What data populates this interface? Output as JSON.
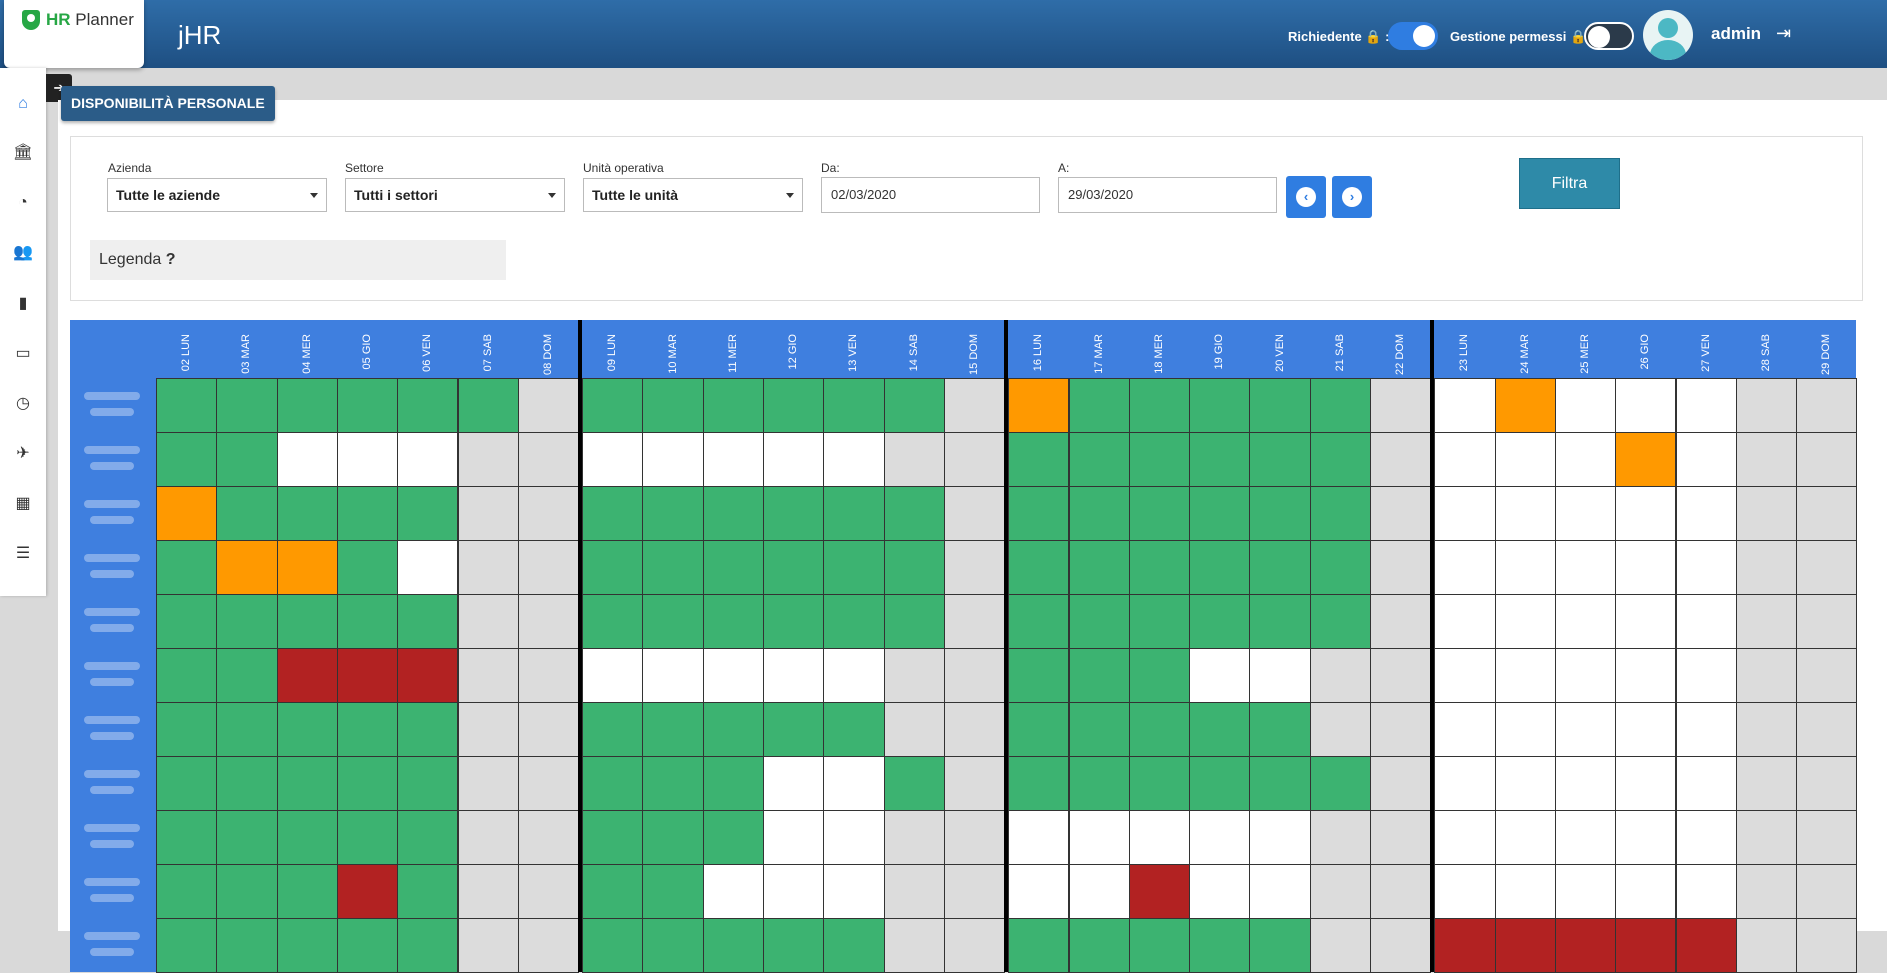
{
  "app": {
    "logo_bold": "HR",
    "logo_rest": " Planner",
    "title": "jHR"
  },
  "header": {
    "richiedente_label": "Richiedente 🔒 :",
    "richiedente_on": true,
    "gestione_label": "Gestione permessi 🔒 :",
    "gestione_on": false,
    "username": "admin",
    "logout_icon": "logout-icon"
  },
  "sidebar": {
    "toggle_icon": "arrow-right-circle-icon",
    "items": [
      {
        "icon": "home-icon",
        "glyph": "⌂"
      },
      {
        "icon": "bank-icon",
        "glyph": "🏛"
      },
      {
        "icon": "pie-chart-icon",
        "glyph": "◔"
      },
      {
        "icon": "users-icon",
        "glyph": "👥"
      },
      {
        "icon": "id-badge-icon",
        "glyph": "▮"
      },
      {
        "icon": "credit-card-icon",
        "glyph": "▭"
      },
      {
        "icon": "clock-icon",
        "glyph": "◷"
      },
      {
        "icon": "plane-icon",
        "glyph": "✈"
      },
      {
        "icon": "calendar-icon",
        "glyph": "▦"
      },
      {
        "icon": "list-icon",
        "glyph": "☰"
      }
    ]
  },
  "page": {
    "badge": "DISPONIBILITÀ PERSONALE"
  },
  "filters": {
    "azienda_label": "Azienda",
    "azienda_value": "Tutte le aziende",
    "settore_label": "Settore",
    "settore_value": "Tutti i settori",
    "unita_label": "Unità operativa",
    "unita_value": "Tutte le unità",
    "da_label": "Da:",
    "da_value": "02/03/2020",
    "a_label": "A:",
    "a_value": "29/03/2020",
    "prev_glyph": "‹",
    "next_glyph": "›",
    "filtra_label": "Filtra",
    "legenda_label": "Legenda",
    "legenda_help": "?"
  },
  "colors": {
    "G": "#3cb371",
    "W": "#ffffff",
    "O": "#ff9900",
    "R": "#b22222",
    "X": "#dcdcdc",
    "header": "#3f7fdf"
  },
  "days": [
    "02 LUN",
    "03 MAR",
    "04 MER",
    "05 GIO",
    "06 VEN",
    "07 SAB",
    "08 DOM",
    "09 LUN",
    "10 MAR",
    "11 MER",
    "12 GIO",
    "13 VEN",
    "14 SAB",
    "15 DOM",
    "16 LUN",
    "17 MAR",
    "18 MER",
    "19 GIO",
    "20 VEN",
    "21 SAB",
    "22 DOM",
    "23 LUN",
    "24 MAR",
    "25 MER",
    "26 GIO",
    "27 VEN",
    "28 SAB",
    "29 DOM"
  ],
  "rows": [
    "GGGGGGXGGGGGGXOGGGGGXWOWWWXX",
    "GGWWWXXWWWWWXXGGGGGGXWWWOWXX",
    "OGGGGXXGGGGGGXGGGGGGXWWWWWXX",
    "GOOGWXXGGGGGGXGGGGGGXWWWWWXX",
    "GGGGGXXGGGGGGXGGGGGGXWWWWWXX",
    "GGRRRXXWWWWWXXGGGWWXXWWWWWXX",
    "GGGGGXXGGGGGXXGGGGGXXWWWWWXX",
    "GGGGGXXGGGWWGXGGGGGGXWWWWWXX",
    "GGGGGXXGGGWWXXWWWWWXXWWWWWXX",
    "GGGRGXXGGWWWXXWWRWWXXWWWWWXX",
    "GGGGGXXGGGGGXXGGGGGXXRRRRRXX"
  ]
}
